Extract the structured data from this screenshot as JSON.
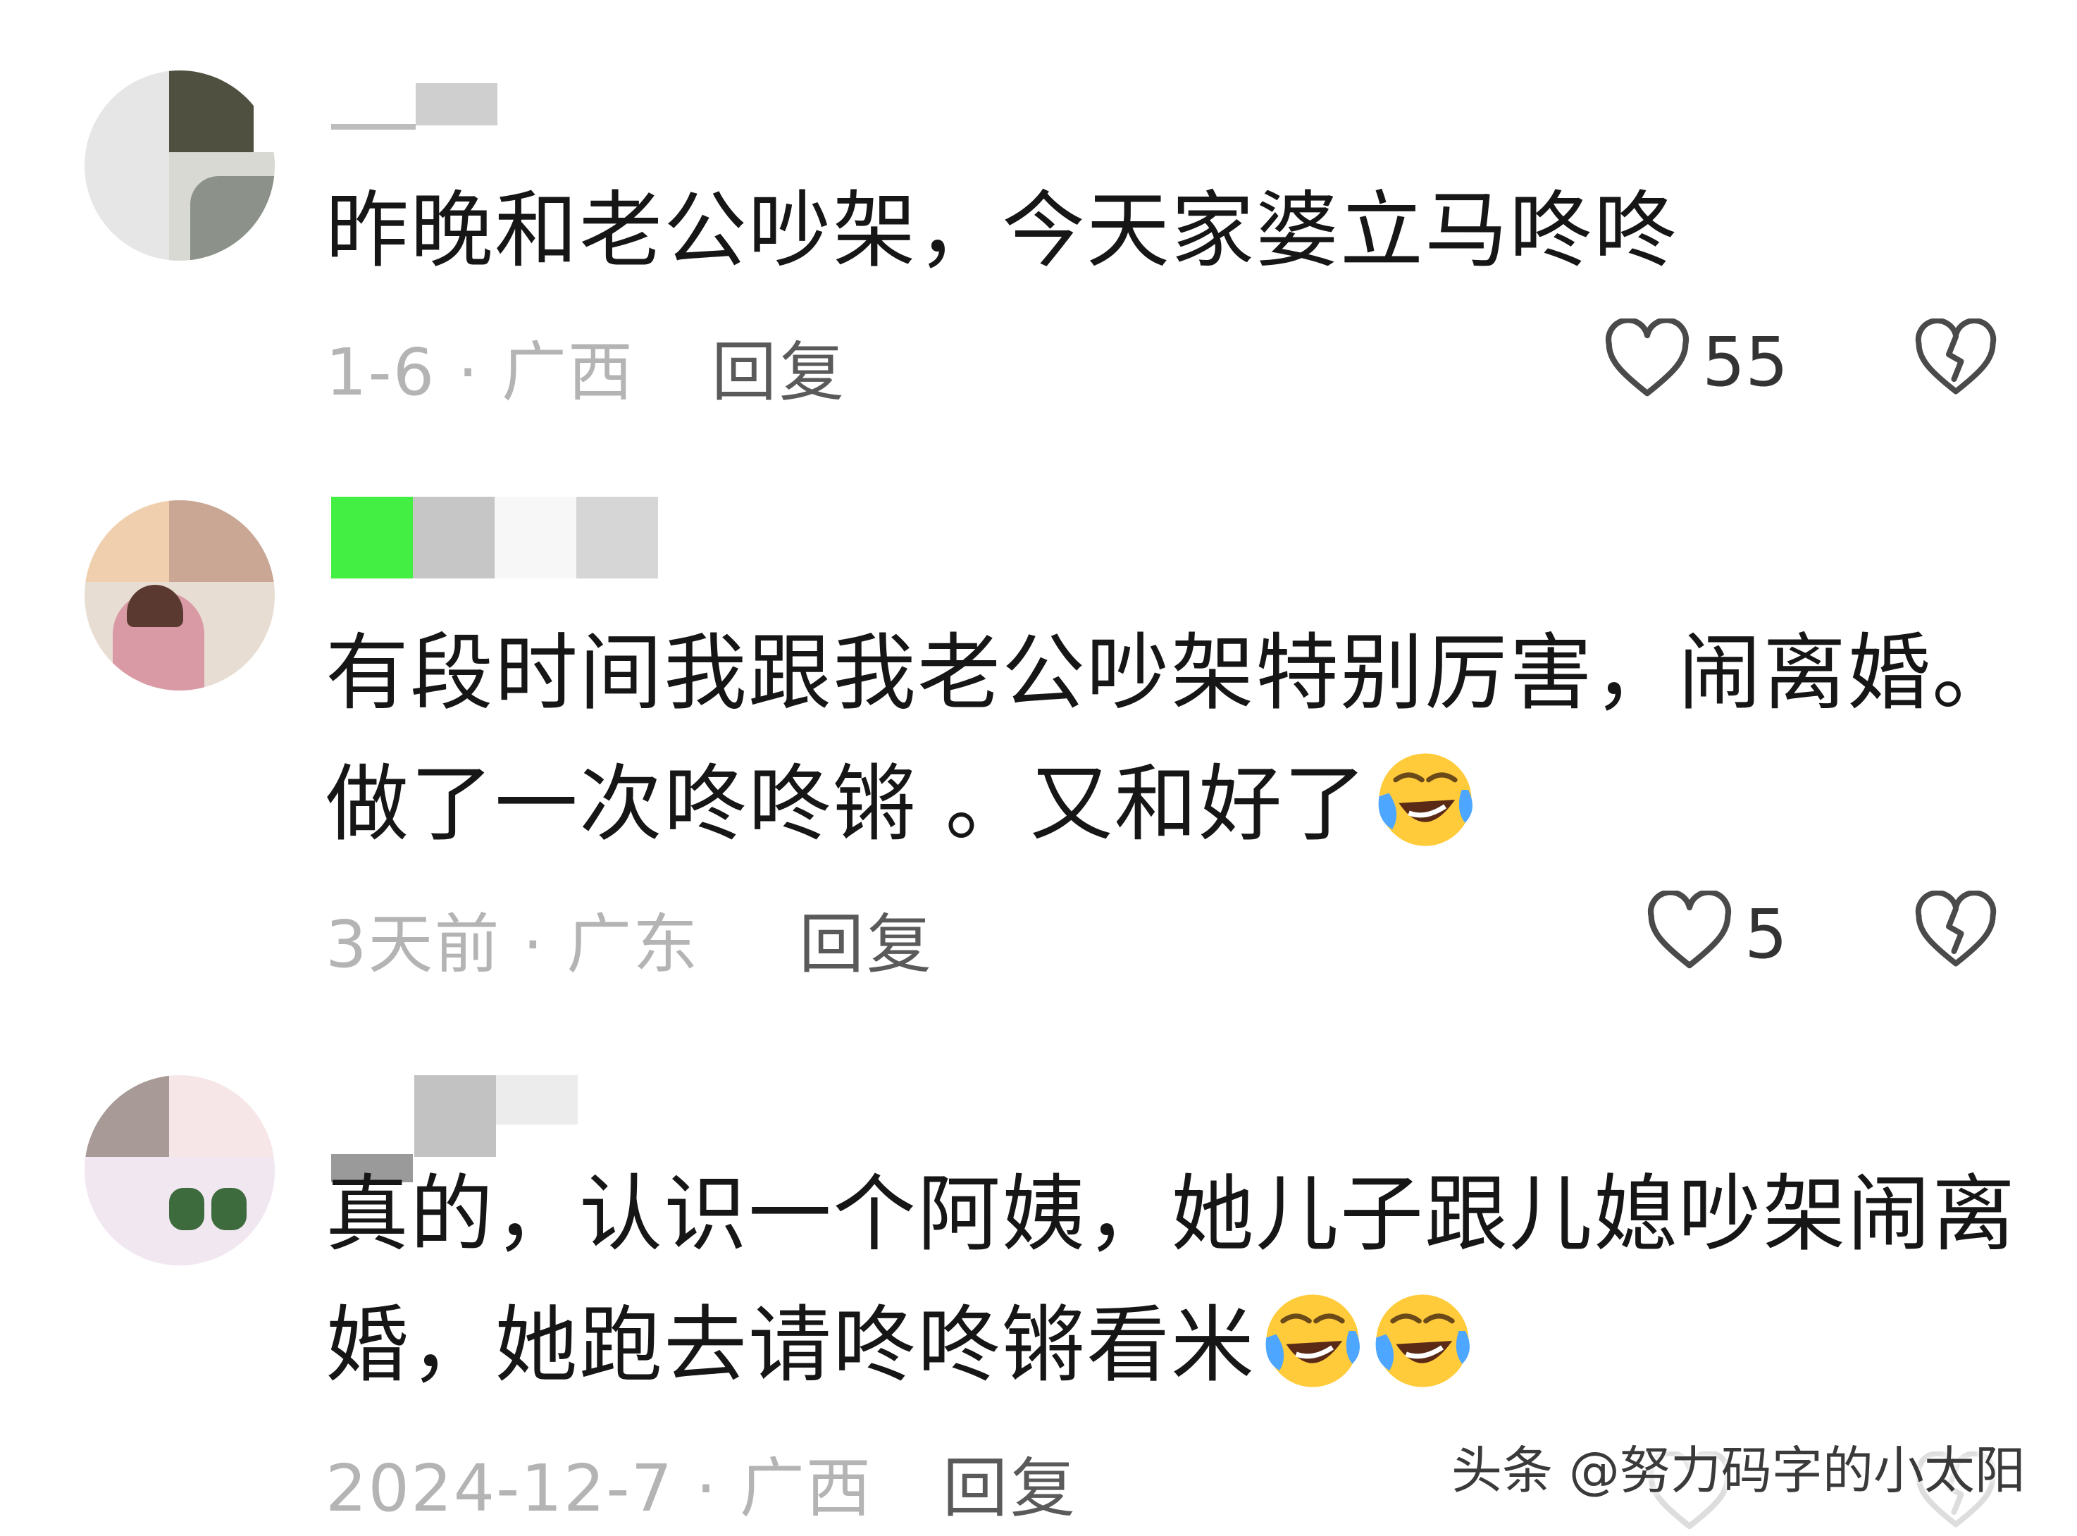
{
  "comments": [
    {
      "text_lines": [
        "昨晚和老公吵架，今天家婆立马咚咚"
      ],
      "date": "1-6",
      "location": "广西",
      "reply_label": "回复",
      "likes": "55"
    },
    {
      "text_lines": [
        "有段时间我跟我老公吵架特别厉害，闹离婚。",
        "做了一次咚咚锵 。又和好了"
      ],
      "date": "3天前",
      "location": "广东",
      "reply_label": "回复",
      "likes": "5"
    },
    {
      "text_lines": [
        "真的，认识一个阿姨，她儿子跟儿媳吵架闹离",
        "婚，她跑去请咚咚锵看米"
      ],
      "date": "2024-12-7",
      "location": "广西",
      "reply_label": "回复",
      "likes": ""
    }
  ],
  "emoji_name": "rofl-emoji",
  "watermark": "头条 @努力码字的小太阳",
  "colors": {
    "text": "#161616",
    "meta": "#b4b4b4",
    "reply": "#5a5a5a",
    "icon_stroke": "#4a4a4a"
  }
}
